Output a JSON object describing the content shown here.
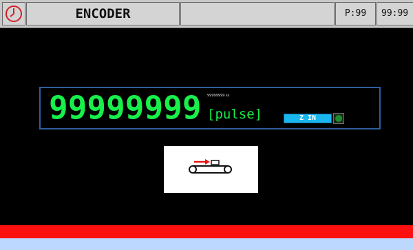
{
  "header": {
    "clock_icon": "clock-icon",
    "title": "ENCODER",
    "program": "P:99",
    "time": "99:99"
  },
  "counter": {
    "value": "99999999",
    "small_label": "99999999 ss",
    "unit": "[pulse]",
    "zin_label": "Z IN",
    "indicator_icon": "led-indicator-icon"
  },
  "conveyor": {
    "icon": "conveyor-belt-icon"
  },
  "colors": {
    "counter_green": "#17f04a",
    "panel_border": "#2f5e9e",
    "zin_blue": "#19b6ef",
    "alarm_bar": "#ff1010",
    "status_bar": "#bcd8ff"
  }
}
